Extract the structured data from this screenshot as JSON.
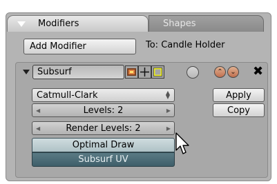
{
  "tabs": [
    {
      "label": "Modifiers",
      "active": true
    },
    {
      "label": "Shapes",
      "active": false
    }
  ],
  "toolbar": {
    "add_modifier_label": "Add Modifier",
    "target_label": "To: Candle Holder"
  },
  "modifier": {
    "name": "Subsurf",
    "subdivision_type": "Catmull-Clark",
    "levels_label": "Levels: 2",
    "render_levels_label": "Render Levels: 2",
    "optimal_draw_label": "Optimal Draw",
    "optimal_draw_enabled": false,
    "subsurf_uv_label": "Subsurf UV",
    "subsurf_uv_enabled": true,
    "apply_label": "Apply",
    "copy_label": "Copy"
  },
  "icons": [
    "collapse-triangle",
    "render-toggle",
    "edit-mode-toggle",
    "cage-toggle",
    "realtime-circle",
    "move-up",
    "move-down",
    "close"
  ],
  "colors": {
    "panel_bg": "#b4b4b4",
    "toggle_on": "#3f5f6a",
    "toggle_off": "#afc2c6"
  }
}
